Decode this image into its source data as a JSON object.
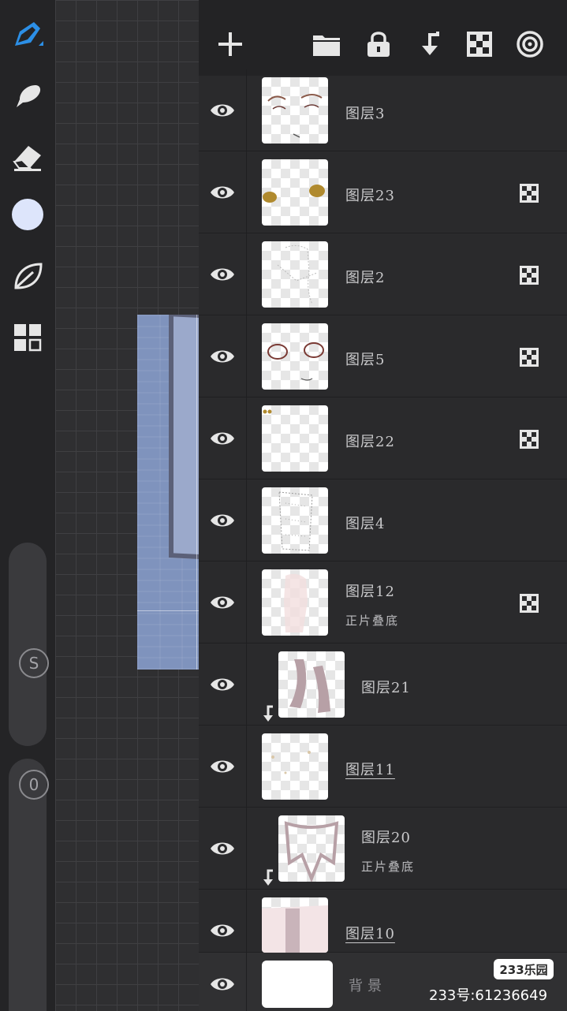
{
  "toolbar": {
    "tools": [
      "brush-icon",
      "smudge-icon",
      "eraser-icon",
      "color-swatch",
      "leaf-icon",
      "layers-grid-icon"
    ],
    "active_color": "#dde5fb",
    "accent": "#2c8fe6",
    "slider_top_label": "S",
    "slider_bottom_label": "0"
  },
  "layers_panel": {
    "actions": [
      "add-layer-icon",
      "folder-icon",
      "lock-icon",
      "merge-down-icon",
      "alpha-lock-icon",
      "reference-icon"
    ],
    "layers": [
      {
        "name": "图层3",
        "mode": "",
        "visible": true,
        "clipped": false,
        "masked": false
      },
      {
        "name": "图层23",
        "mode": "",
        "visible": true,
        "clipped": false,
        "masked": true
      },
      {
        "name": "图层2",
        "mode": "",
        "visible": true,
        "clipped": false,
        "masked": true
      },
      {
        "name": "图层5",
        "mode": "",
        "visible": true,
        "clipped": false,
        "masked": true
      },
      {
        "name": "图层22",
        "mode": "",
        "visible": true,
        "clipped": false,
        "masked": true
      },
      {
        "name": "图层4",
        "mode": "",
        "visible": true,
        "clipped": false,
        "masked": false
      },
      {
        "name": "图层12",
        "mode": "正片叠底",
        "visible": true,
        "clipped": false,
        "masked": true
      },
      {
        "name": "图层21",
        "mode": "",
        "visible": true,
        "clipped": true,
        "masked": false
      },
      {
        "name": "图层11",
        "mode": "",
        "visible": true,
        "clipped": false,
        "masked": false
      },
      {
        "name": "图层20",
        "mode": "正片叠底",
        "visible": true,
        "clipped": true,
        "masked": false
      },
      {
        "name": "图层10",
        "mode": "",
        "visible": true,
        "clipped": false,
        "masked": false
      },
      {
        "name": "背景",
        "mode": "",
        "visible": true,
        "clipped": false,
        "masked": false
      }
    ]
  },
  "watermark": {
    "badge": "233乐园",
    "id_text": "233号:61236649"
  }
}
